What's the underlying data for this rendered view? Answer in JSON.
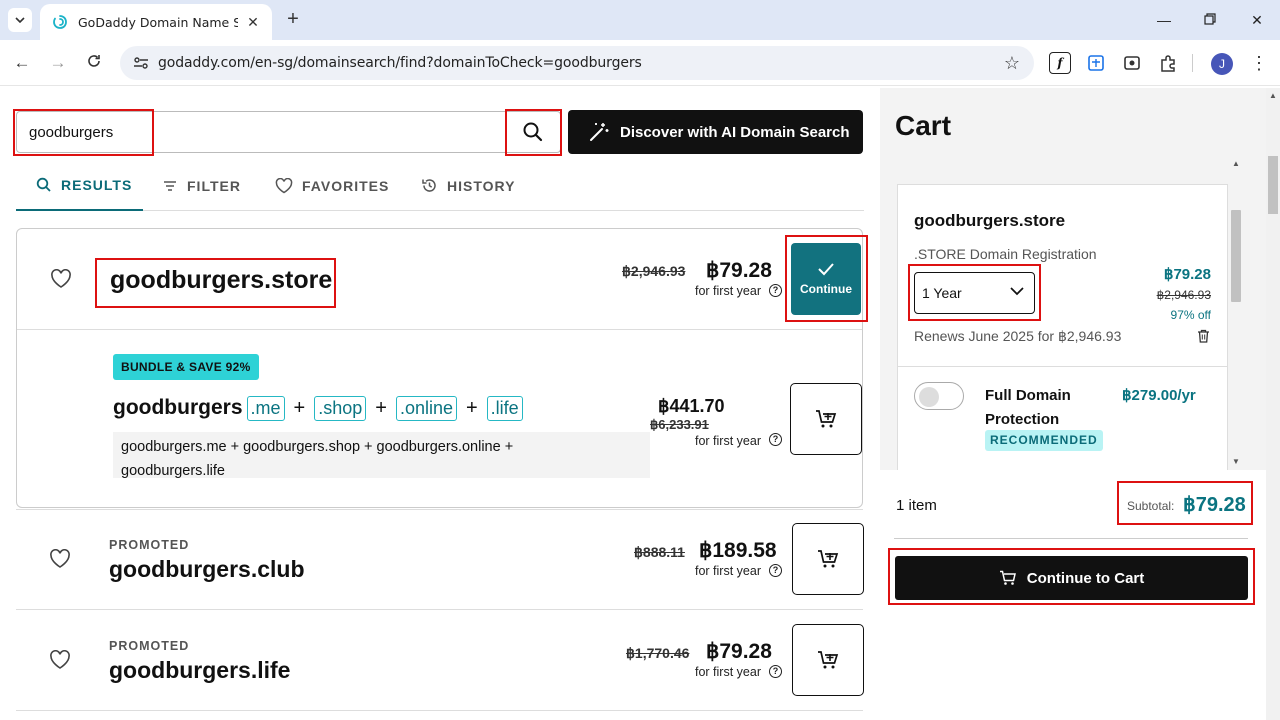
{
  "browser": {
    "tab_title": "GoDaddy Domain Name Search",
    "url": "godaddy.com/en-sg/domainsearch/find?domainToCheck=goodburgers",
    "profile_initial": "J"
  },
  "search": {
    "value": "goodburgers",
    "ai_button_label": "Discover with AI Domain Search"
  },
  "result_tabs": [
    {
      "label": "RESULTS"
    },
    {
      "label": "FILTER"
    },
    {
      "label": "FAVORITES"
    },
    {
      "label": "HISTORY"
    }
  ],
  "exact_match": {
    "domain": "goodburgers.store",
    "old_price": "฿2,946.93",
    "price": "฿79.28",
    "term": "for first year",
    "button_label": "Continue"
  },
  "bundle": {
    "badge": "BUNDLE & SAVE 92%",
    "base": "goodburgers",
    "tlds": [
      ".me",
      ".shop",
      ".online",
      ".life"
    ],
    "plus": "+",
    "list_line1": "goodburgers.me + goodburgers.shop + goodburgers.online +",
    "list_line2": "goodburgers.life",
    "price": "฿441.70",
    "old_price": "฿6,233.91",
    "term": "for first year"
  },
  "results": [
    {
      "tag": "PROMOTED",
      "domain": "goodburgers.club",
      "old_price": "฿888.11",
      "price": "฿189.58",
      "term": "for first year"
    },
    {
      "tag": "PROMOTED",
      "domain": "goodburgers.life",
      "old_price": "฿1,770.46",
      "price": "฿79.28",
      "term": "for first year"
    }
  ],
  "cart": {
    "title": "Cart",
    "item": {
      "name": "goodburgers.store",
      "type": ".STORE Domain Registration",
      "term_select": "1 Year",
      "price": "฿79.28",
      "old_price": "฿2,946.93",
      "discount": "97% off",
      "renewal": "Renews June 2025 for ฿2,946.93"
    },
    "addon": {
      "name": "Full Domain Protection",
      "price": "฿279.00/yr",
      "badge": "RECOMMENDED",
      "enabled": false
    },
    "item_count": "1 item",
    "subtotal_label": "Subtotal:",
    "subtotal_value": "฿79.28",
    "checkout_label": "Continue to Cart"
  },
  "colors": {
    "accent_teal": "#0b7481",
    "highlight_red": "#dd1111",
    "bundle_badge": "#2ed2d6"
  }
}
